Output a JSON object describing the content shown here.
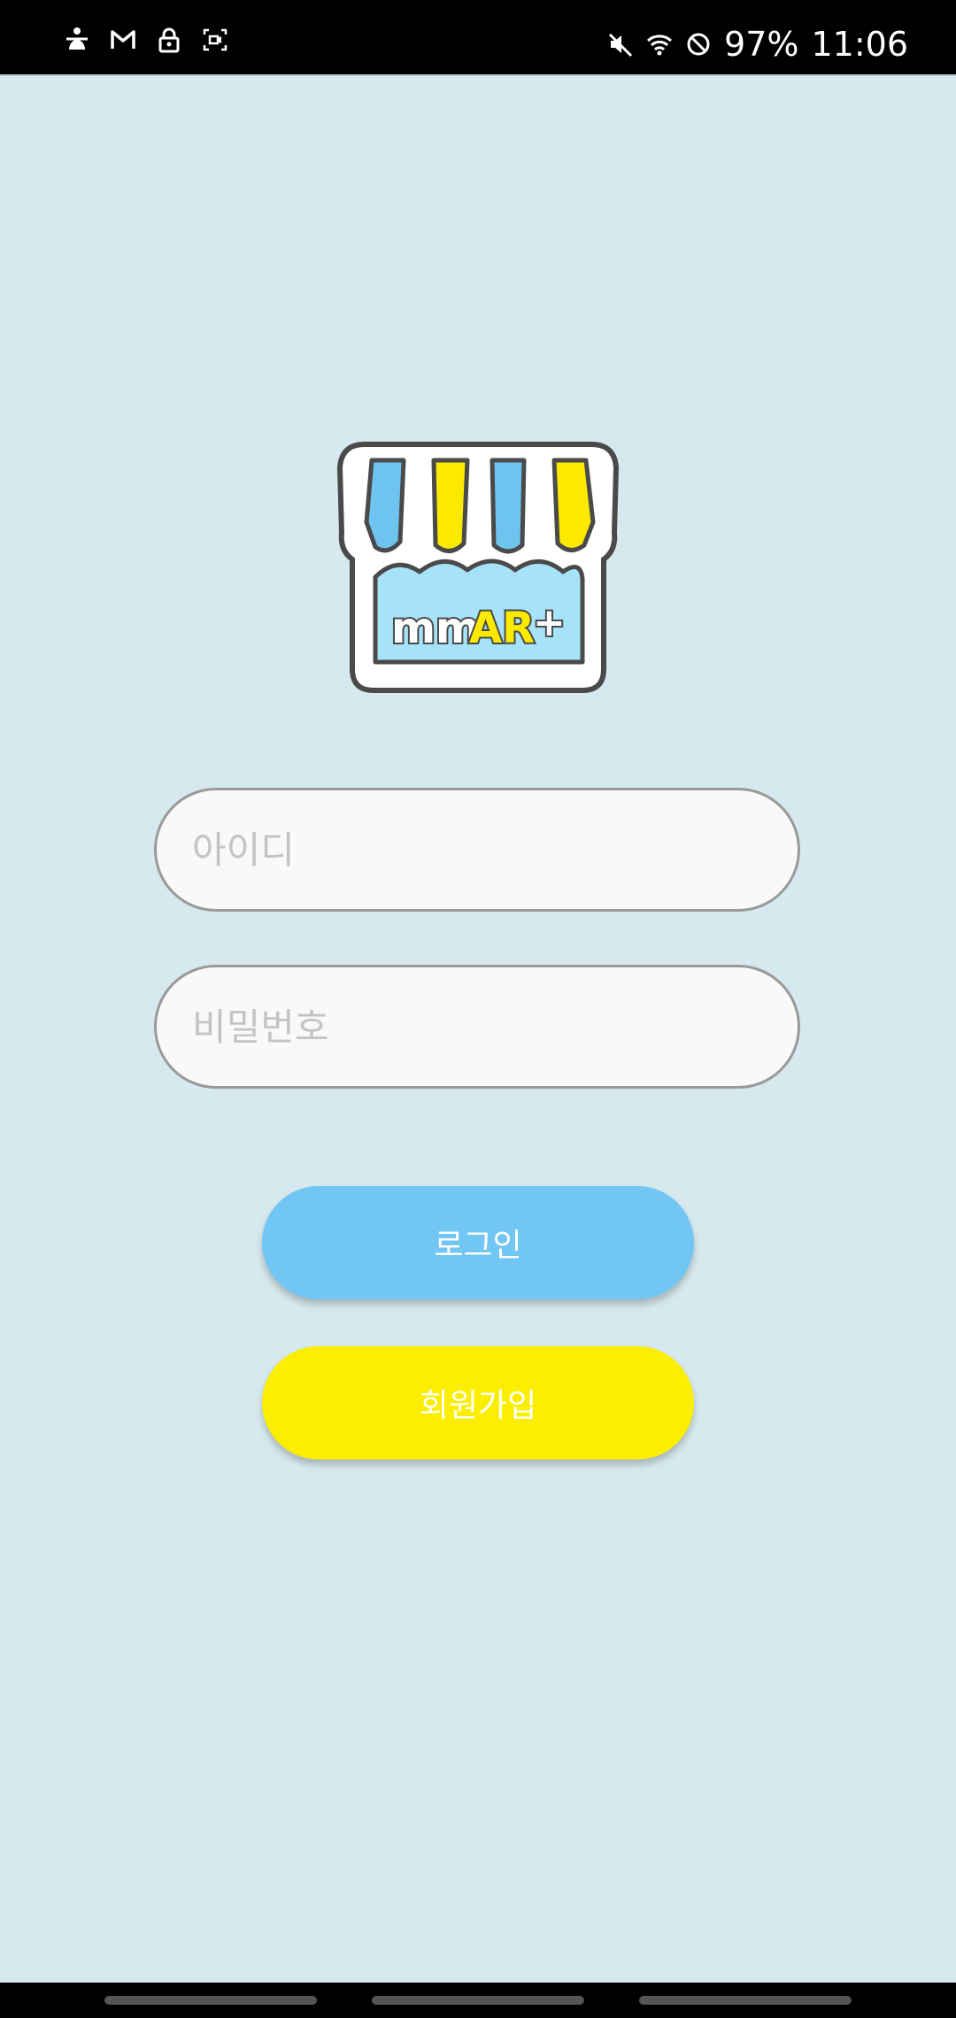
{
  "status_bar": {
    "left_icons": [
      "accessibility-icon",
      "gmail-icon",
      "lock-icon",
      "screen-record-icon"
    ],
    "right_icons": [
      "mute-icon",
      "wifi-icon",
      "do-not-disturb-icon"
    ],
    "battery": "97%",
    "time": "11:06"
  },
  "logo": {
    "text_mm": "mm",
    "text_ar": "AR",
    "text_plus": "+"
  },
  "login_form": {
    "id_placeholder": "아이디",
    "password_placeholder": "비밀번호",
    "login_label": "로그인",
    "signup_label": "회원가입"
  },
  "colors": {
    "background": "#d6e9ee",
    "login_button": "#71c6f4",
    "signup_button": "#fbee00",
    "field_border": "#9a9a9a",
    "awning_blue": "#6fc4ef",
    "awning_yellow": "#fbe900"
  }
}
